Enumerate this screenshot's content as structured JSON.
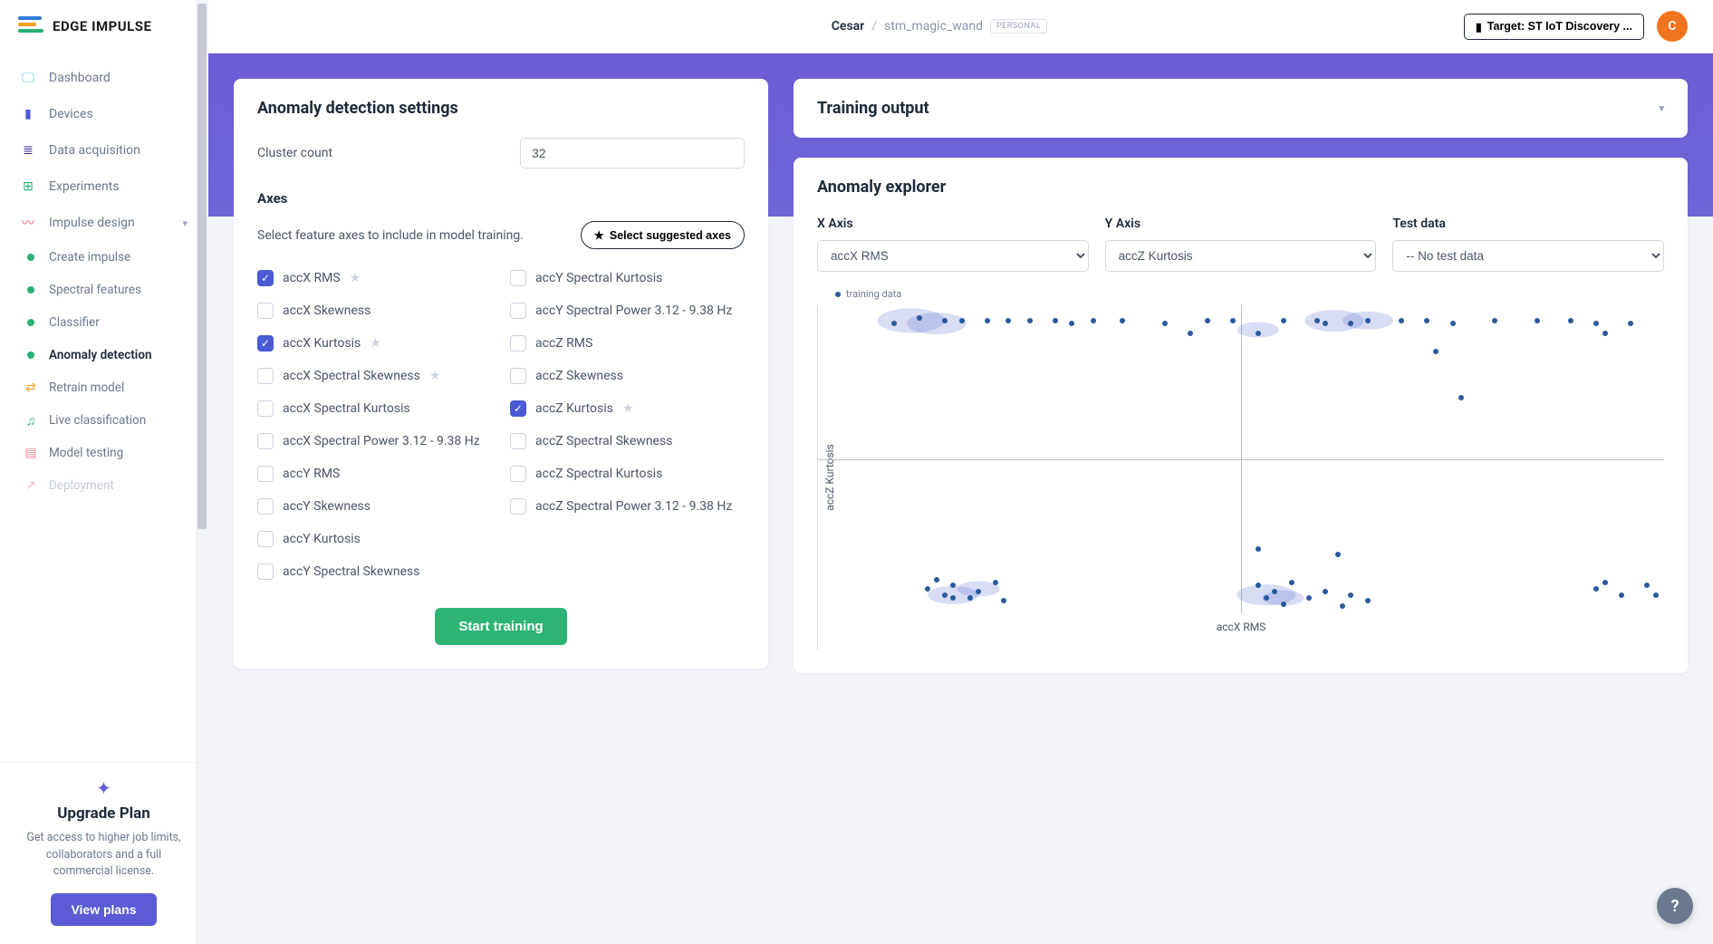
{
  "brand": "EDGE IMPULSE",
  "nav": {
    "dashboard": "Dashboard",
    "devices": "Devices",
    "data": "Data acquisition",
    "experiments": "Experiments",
    "impulse": "Impulse design",
    "create_impulse": "Create impulse",
    "spectral": "Spectral features",
    "classifier": "Classifier",
    "anomaly": "Anomaly detection",
    "retrain": "Retrain model",
    "live": "Live classification",
    "testing": "Model testing",
    "deployment": "Deployment"
  },
  "upgrade": {
    "title": "Upgrade Plan",
    "text": "Get access to higher job limits, collaborators and a full commercial license.",
    "button": "View plans"
  },
  "breadcrumb": {
    "user": "Cesar",
    "project": "stm_magic_wand",
    "badge": "PERSONAL"
  },
  "target": {
    "label": "Target: ST IoT Discovery ..."
  },
  "avatar": "C",
  "settings": {
    "title": "Anomaly detection settings",
    "cluster_label": "Cluster count",
    "cluster_value": "32",
    "axes_title": "Axes",
    "axes_desc": "Select feature axes to include in model training.",
    "suggest_button": "Select suggested axes",
    "train_button": "Start training",
    "axes_left": [
      {
        "label": "accX RMS",
        "checked": true,
        "star": true
      },
      {
        "label": "accX Skewness",
        "checked": false,
        "star": false
      },
      {
        "label": "accX Kurtosis",
        "checked": true,
        "star": true
      },
      {
        "label": "accX Spectral Skewness",
        "checked": false,
        "star": true
      },
      {
        "label": "accX Spectral Kurtosis",
        "checked": false,
        "star": false
      },
      {
        "label": "accX Spectral Power 3.12 - 9.38 Hz",
        "checked": false,
        "star": false
      },
      {
        "label": "accY RMS",
        "checked": false,
        "star": false
      },
      {
        "label": "accY Skewness",
        "checked": false,
        "star": false
      },
      {
        "label": "accY Kurtosis",
        "checked": false,
        "star": false
      },
      {
        "label": "accY Spectral Skewness",
        "checked": false,
        "star": false
      }
    ],
    "axes_right": [
      {
        "label": "accY Spectral Kurtosis",
        "checked": false,
        "star": false
      },
      {
        "label": "accY Spectral Power 3.12 - 9.38 Hz",
        "checked": false,
        "star": false
      },
      {
        "label": "accZ RMS",
        "checked": false,
        "star": false
      },
      {
        "label": "accZ Skewness",
        "checked": false,
        "star": false
      },
      {
        "label": "accZ Kurtosis",
        "checked": true,
        "star": true
      },
      {
        "label": "accZ Spectral Skewness",
        "checked": false,
        "star": false
      },
      {
        "label": "accZ Spectral Kurtosis",
        "checked": false,
        "star": false
      },
      {
        "label": "accZ Spectral Power 3.12 - 9.38 Hz",
        "checked": false,
        "star": false
      }
    ]
  },
  "training_output": {
    "title": "Training output"
  },
  "explorer": {
    "title": "Anomaly explorer",
    "xaxis_label": "X Axis",
    "yaxis_label": "Y Axis",
    "testdata_label": "Test data",
    "xaxis_value": "accX RMS",
    "yaxis_value": "accZ Kurtosis",
    "testdata_value": "-- No test data",
    "legend": "training data",
    "xlabel": "accX RMS",
    "ylabel": "accZ Kurtosis"
  },
  "chart_data": {
    "type": "scatter",
    "title": "Anomaly explorer",
    "xlabel": "accX RMS",
    "ylabel": "accZ Kurtosis",
    "series": [
      {
        "name": "training data",
        "points": [
          {
            "x": -0.82,
            "y": 0.88
          },
          {
            "x": -0.76,
            "y": 0.92
          },
          {
            "x": -0.7,
            "y": 0.9
          },
          {
            "x": -0.66,
            "y": 0.9
          },
          {
            "x": -0.6,
            "y": 0.9
          },
          {
            "x": -0.55,
            "y": 0.9
          },
          {
            "x": -0.5,
            "y": 0.9
          },
          {
            "x": -0.44,
            "y": 0.9
          },
          {
            "x": -0.4,
            "y": 0.88
          },
          {
            "x": -0.35,
            "y": 0.9
          },
          {
            "x": -0.28,
            "y": 0.9
          },
          {
            "x": -0.18,
            "y": 0.88
          },
          {
            "x": -0.12,
            "y": 0.82
          },
          {
            "x": -0.08,
            "y": 0.9
          },
          {
            "x": -0.02,
            "y": 0.9
          },
          {
            "x": 0.04,
            "y": 0.82
          },
          {
            "x": 0.1,
            "y": 0.9
          },
          {
            "x": 0.18,
            "y": 0.9
          },
          {
            "x": 0.2,
            "y": 0.88
          },
          {
            "x": 0.26,
            "y": 0.88
          },
          {
            "x": 0.3,
            "y": 0.9
          },
          {
            "x": 0.38,
            "y": 0.9
          },
          {
            "x": 0.44,
            "y": 0.9
          },
          {
            "x": 0.5,
            "y": 0.88
          },
          {
            "x": 0.6,
            "y": 0.9
          },
          {
            "x": 0.7,
            "y": 0.9
          },
          {
            "x": 0.78,
            "y": 0.9
          },
          {
            "x": 0.84,
            "y": 0.88
          },
          {
            "x": 0.92,
            "y": 0.88
          },
          {
            "x": 0.86,
            "y": 0.82
          },
          {
            "x": 0.46,
            "y": 0.7
          },
          {
            "x": 0.52,
            "y": 0.4
          },
          {
            "x": -0.72,
            "y": -0.78
          },
          {
            "x": -0.68,
            "y": -0.82
          },
          {
            "x": -0.64,
            "y": -0.9
          },
          {
            "x": -0.62,
            "y": -0.86
          },
          {
            "x": -0.58,
            "y": -0.8
          },
          {
            "x": -0.68,
            "y": -0.9
          },
          {
            "x": -0.56,
            "y": -0.92
          },
          {
            "x": -0.7,
            "y": -0.88
          },
          {
            "x": -0.74,
            "y": -0.84
          },
          {
            "x": 0.04,
            "y": -0.82
          },
          {
            "x": 0.08,
            "y": -0.86
          },
          {
            "x": 0.06,
            "y": -0.9
          },
          {
            "x": 0.12,
            "y": -0.8
          },
          {
            "x": 0.16,
            "y": -0.9
          },
          {
            "x": 0.1,
            "y": -0.94
          },
          {
            "x": 0.2,
            "y": -0.86
          },
          {
            "x": 0.26,
            "y": -0.88
          },
          {
            "x": 0.24,
            "y": -0.95
          },
          {
            "x": 0.3,
            "y": -0.92
          },
          {
            "x": 0.84,
            "y": -0.84
          },
          {
            "x": 0.86,
            "y": -0.8
          },
          {
            "x": 0.9,
            "y": -0.88
          },
          {
            "x": 0.96,
            "y": -0.82
          },
          {
            "x": 0.98,
            "y": -0.88
          },
          {
            "x": 0.23,
            "y": -0.62
          },
          {
            "x": 0.04,
            "y": -0.58
          }
        ]
      }
    ],
    "halos": [
      {
        "x": -0.78,
        "y": 0.9,
        "r": 0.08
      },
      {
        "x": -0.72,
        "y": 0.88,
        "r": 0.07
      },
      {
        "x": 0.22,
        "y": 0.9,
        "r": 0.07
      },
      {
        "x": 0.3,
        "y": 0.9,
        "r": 0.06
      },
      {
        "x": 0.04,
        "y": 0.84,
        "r": 0.05
      },
      {
        "x": -0.68,
        "y": -0.88,
        "r": 0.06
      },
      {
        "x": -0.62,
        "y": -0.84,
        "r": 0.05
      },
      {
        "x": 0.06,
        "y": -0.88,
        "r": 0.07
      },
      {
        "x": 0.1,
        "y": -0.9,
        "r": 0.05
      }
    ],
    "xlim": [
      -1,
      1
    ],
    "ylim": [
      -1,
      1
    ]
  }
}
